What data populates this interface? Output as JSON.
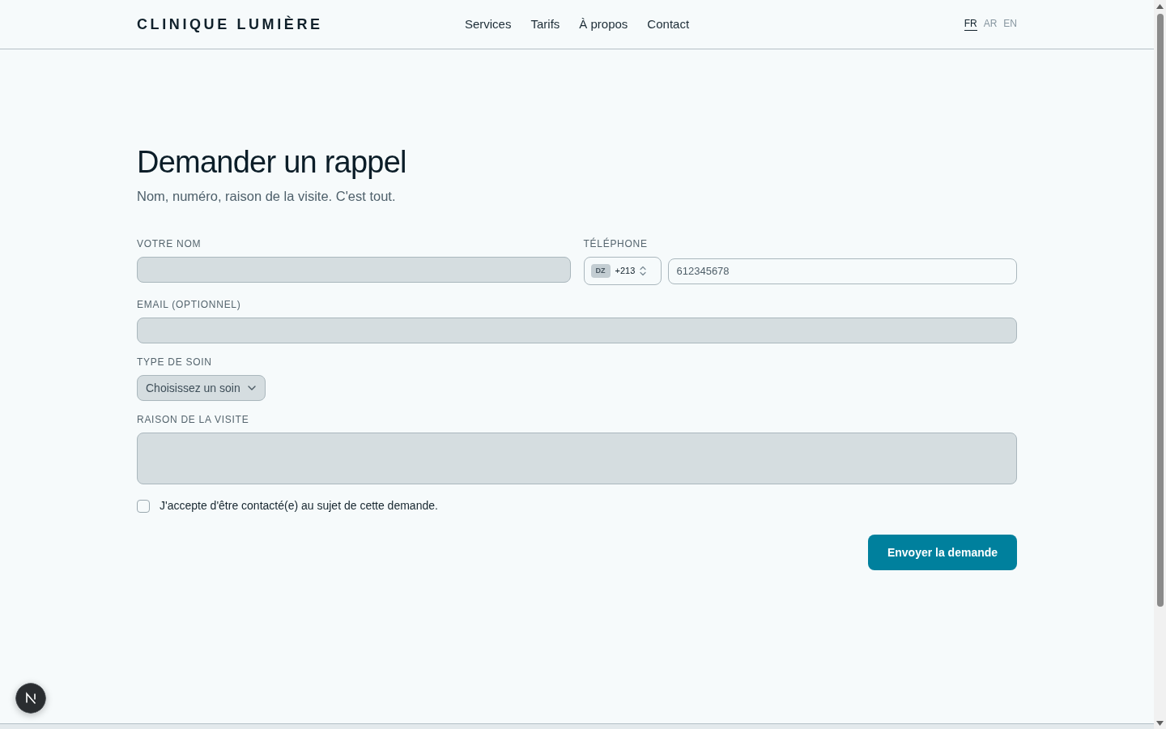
{
  "header": {
    "brand": "CLINIQUE LUMIÈRE",
    "nav": [
      "Services",
      "Tarifs",
      "À propos",
      "Contact"
    ],
    "languages": [
      {
        "label": "FR",
        "selected": true
      },
      {
        "label": "AR",
        "selected": false
      },
      {
        "label": "EN",
        "selected": false
      }
    ]
  },
  "form": {
    "title": "Demander un rappel",
    "subtitle": "Nom, numéro, raison de la visite. C'est tout.",
    "name": {
      "label": "VOTRE NOM"
    },
    "phone": {
      "label": "TÉLÉPHONE",
      "country_code": "DZ",
      "dial_code": "+213",
      "placeholder": "612345678"
    },
    "email": {
      "label": "EMAIL (OPTIONNEL)"
    },
    "care_type": {
      "label": "TYPE DE SOIN",
      "value": "Choisissez un soin"
    },
    "reason": {
      "label": "RAISON DE LA VISITE"
    },
    "consent": {
      "label": "J'accepte d'être contacté(e) au sujet de cette demande.",
      "checked": false
    },
    "submit": "Envoyer la demande"
  }
}
